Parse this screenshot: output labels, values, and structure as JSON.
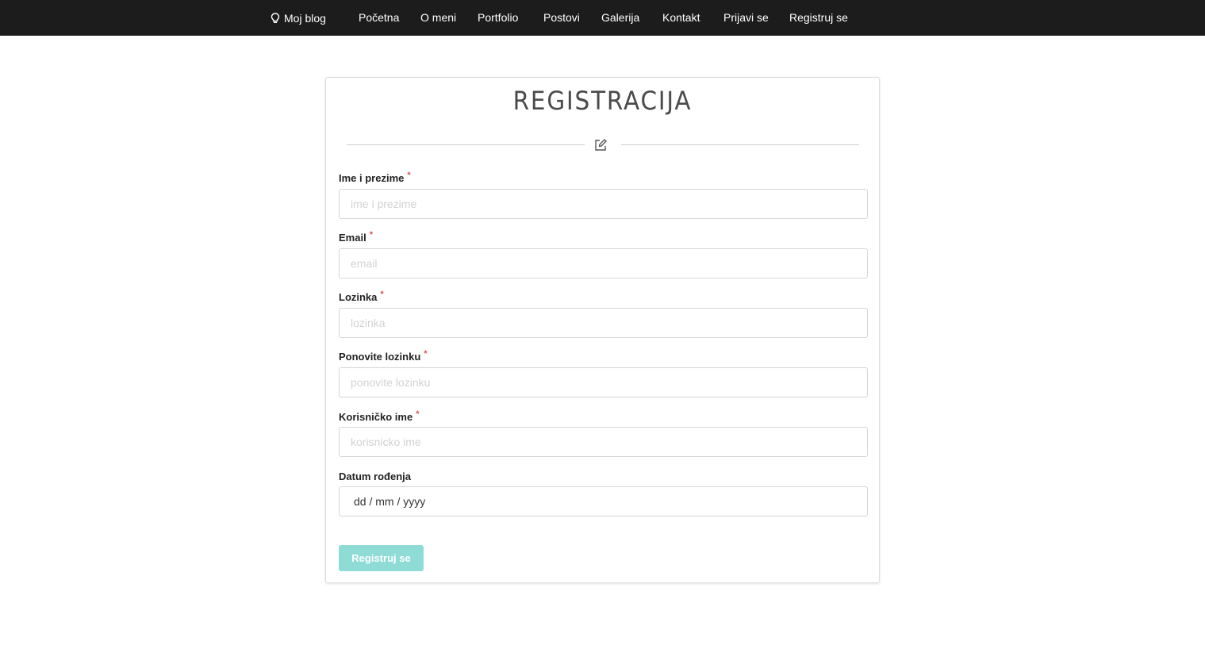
{
  "nav": {
    "brand": "Moj blog",
    "brand_icon": "lightbulb-icon",
    "items": [
      "Početna",
      "O meni",
      "Portfolio",
      "Postovi",
      "Galerija",
      "Kontakt",
      "Prijavi se",
      "Registruj se"
    ]
  },
  "form": {
    "title": "REGISTRACIJA",
    "divider_icon": "edit-icon",
    "required_mark": "*",
    "fields": [
      {
        "label": "Ime i prezime",
        "placeholder": "ime i prezime",
        "required": true
      },
      {
        "label": "Email",
        "placeholder": "email",
        "required": true
      },
      {
        "label": "Lozinka",
        "placeholder": "lozinka",
        "required": true
      },
      {
        "label": "Ponovite lozinku",
        "placeholder": "ponovite lozinku",
        "required": true
      },
      {
        "label": "Korisničko ime",
        "placeholder": "korisnicko ime",
        "required": true
      },
      {
        "label": "Datum rođenja",
        "placeholder": "dd / mm / yyyy",
        "required": false
      }
    ],
    "submit_label": "Registruj se"
  },
  "colors": {
    "navbar_bg": "#1c1c1c",
    "button_bg": "#8fdcd7",
    "required": "#d9534f"
  }
}
